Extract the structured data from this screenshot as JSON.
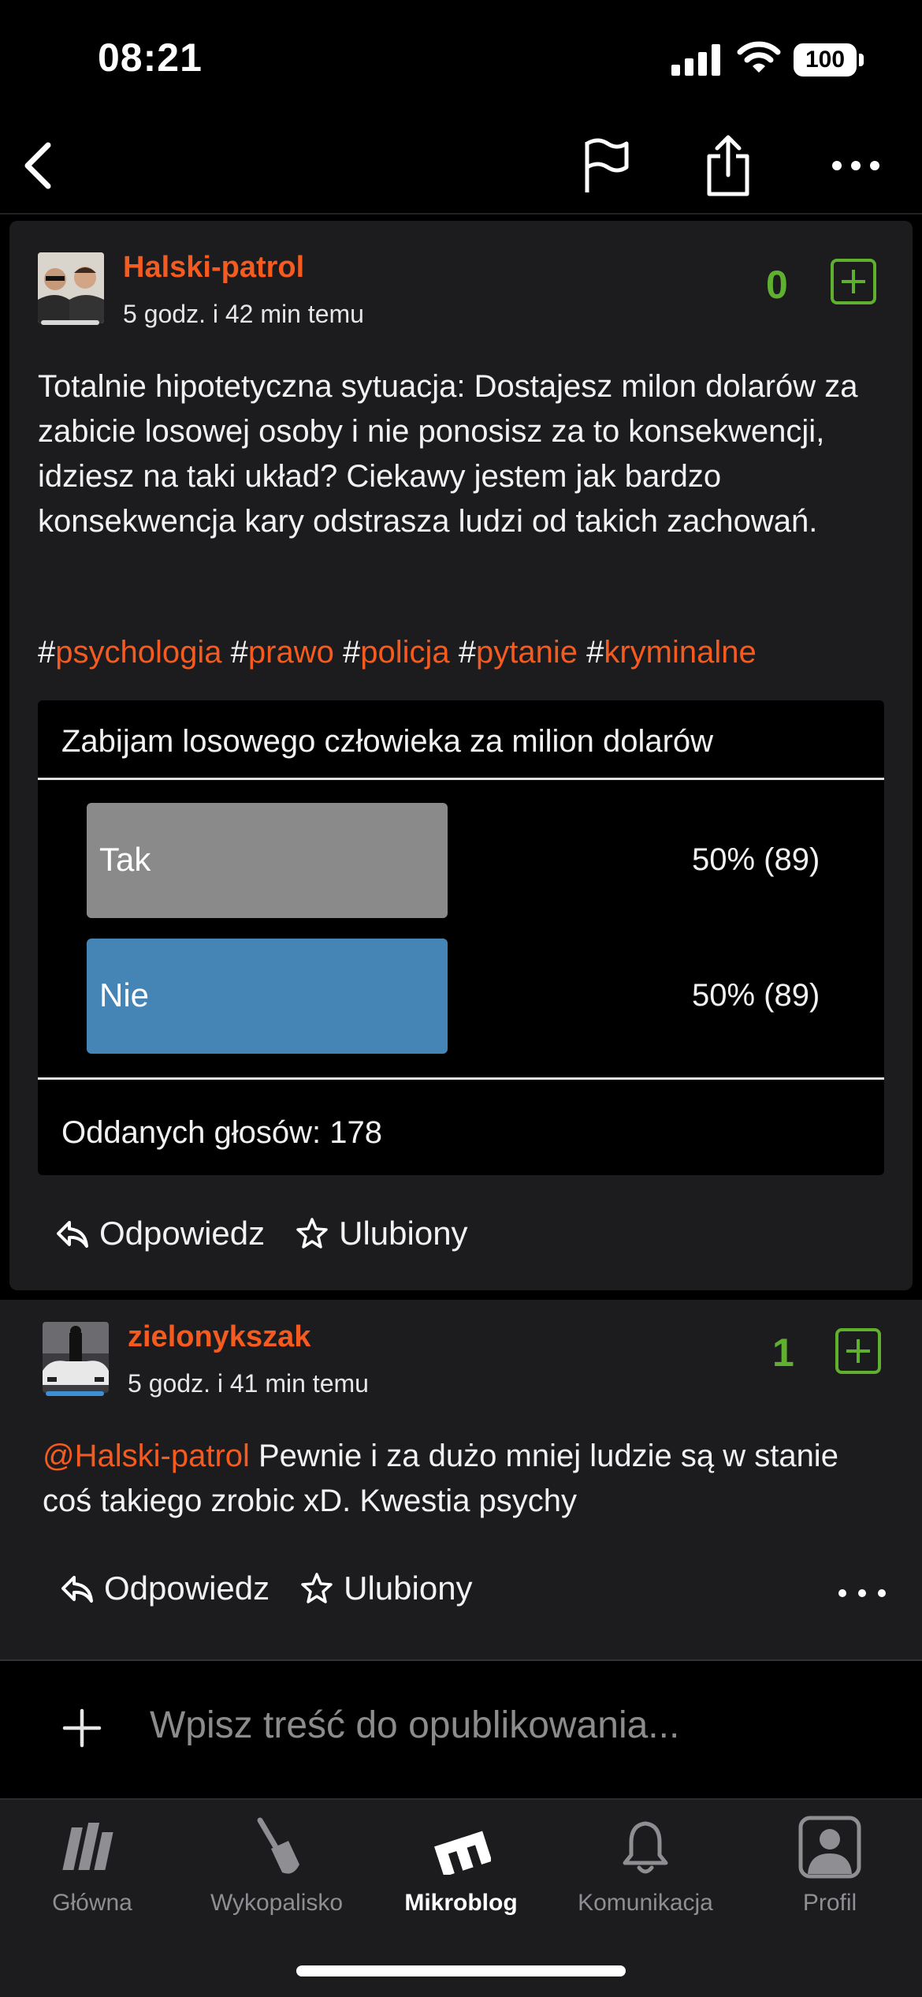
{
  "status_bar": {
    "time": "08:21",
    "battery": "100"
  },
  "topbar": {
    "back_icon": "chevron-left-icon",
    "flag_icon": "flag-icon",
    "share_icon": "share-icon",
    "more_icon": "more-horizontal-icon"
  },
  "post": {
    "author": "Halski-patrol",
    "time_ago": "5 godz. i 42 min temu",
    "votes": "0",
    "text": " Totalnie hipotetyczna sytuacja: Dostajesz milon dolarów za zabicie losowej osoby i nie ponosisz za to konsekwencji, idziesz na taki układ? Ciekawy jestem jak bardzo konsekwencja kary odstrasza ludzi od takich zachowań.",
    "tags": [
      "psychologia",
      "prawo",
      "policja",
      "pytanie",
      "kryminalne"
    ],
    "poll": {
      "question": "Zabijam losowego człowieka za milion dolarów",
      "options": [
        {
          "label": "Tak",
          "result": "50% (89)",
          "share": 0.5,
          "color": "#8a8a8a"
        },
        {
          "label": "Nie",
          "result": "50% (89)",
          "share": 0.5,
          "color": "#4585b5"
        }
      ],
      "total": "Oddanych głosów: 178"
    },
    "reply_label": "Odpowiedz",
    "favorite_label": "Ulubiony"
  },
  "reply": {
    "author": "zielonykszak",
    "time_ago": "5 godz. i 41 min temu",
    "votes": "1",
    "mention": "@Halski-patrol",
    "text": " Pewnie i za dużo mniej ludzie są w stanie coś takiego zrobic xD. Kwestia psychy",
    "reply_label": "Odpowiedz",
    "favorite_label": "Ulubiony"
  },
  "composer": {
    "placeholder": "Wpisz treść do opublikowania..."
  },
  "tabs": [
    {
      "label": "Główna",
      "icon": "home-logo-icon"
    },
    {
      "label": "Wykopalisko",
      "icon": "shovel-icon"
    },
    {
      "label": "Mikroblog",
      "icon": "mikroblog-logo-icon",
      "active": true
    },
    {
      "label": "Komunikacja",
      "icon": "bell-icon"
    },
    {
      "label": "Profil",
      "icon": "profile-icon"
    }
  ],
  "colors": {
    "accent": "#f55a1f",
    "vote_green": "#5fb02f",
    "card_bg": "#1c1c1e"
  }
}
